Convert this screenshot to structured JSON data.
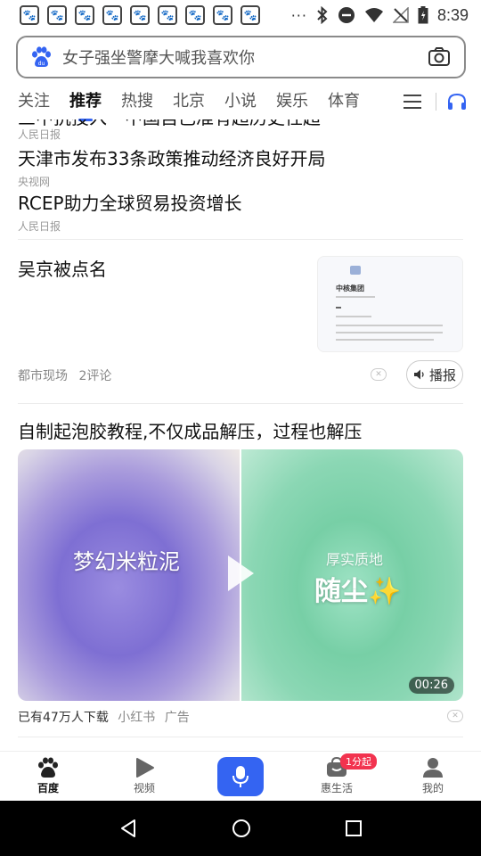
{
  "status_bar": {
    "notification_icons": [
      "baidu-paw-icon",
      "baidu-paw-icon",
      "baidu-paw-icon",
      "baidu-paw-icon",
      "baidu-paw-icon",
      "baidu-paw-icon",
      "baidu-paw-icon",
      "baidu-paw-icon",
      "baidu-paw-icon"
    ],
    "more": "···",
    "time": "8:39"
  },
  "search": {
    "placeholder": "女子强坐警摩大喊我喜欢你"
  },
  "tabs": [
    {
      "label": "关注",
      "active": false
    },
    {
      "label": "推荐",
      "active": true
    },
    {
      "label": "热搜",
      "active": false
    },
    {
      "label": "北京",
      "active": false
    },
    {
      "label": "小说",
      "active": false
    },
    {
      "label": "娱乐",
      "active": false
    },
    {
      "label": "体育",
      "active": false
    }
  ],
  "feed": {
    "partial_news": {
      "title": "三中抗投入一中国自己准有超历史性超",
      "source": "人民日报"
    },
    "news": [
      {
        "title": "天津市发布33条政策推动经济良好开局",
        "source": "央视网"
      },
      {
        "title": "RCEP助力全球贸易投资增长",
        "source": "人民日报"
      }
    ],
    "article": {
      "title": "吴京被点名",
      "source": "都市现场",
      "comments": "2评论",
      "play_label": "播报",
      "thumb_heading": "中核集团"
    },
    "video_ad": {
      "title": "自制起泡胶教程,不仅成品解压，过程也解压",
      "left_caption": "梦幻米粒泥",
      "right_caption_small": "厚实质地",
      "right_caption_big": "随尘✨",
      "duration": "00:26",
      "downloads": "已有47万人下载",
      "advertiser": "小红书",
      "ad_label": "广告"
    }
  },
  "bottom_nav": [
    {
      "label": "百度",
      "icon": "baidu-paw-icon",
      "active": true
    },
    {
      "label": "视频",
      "icon": "video-play-icon",
      "active": false
    },
    {
      "label": "",
      "icon": "microphone-icon",
      "active": false
    },
    {
      "label": "惠生活",
      "icon": "shopping-icon",
      "active": false,
      "badge": "1分起"
    },
    {
      "label": "我的",
      "icon": "user-icon",
      "active": false
    }
  ],
  "colors": {
    "accent": "#3464f2",
    "badge": "#f2334f"
  }
}
